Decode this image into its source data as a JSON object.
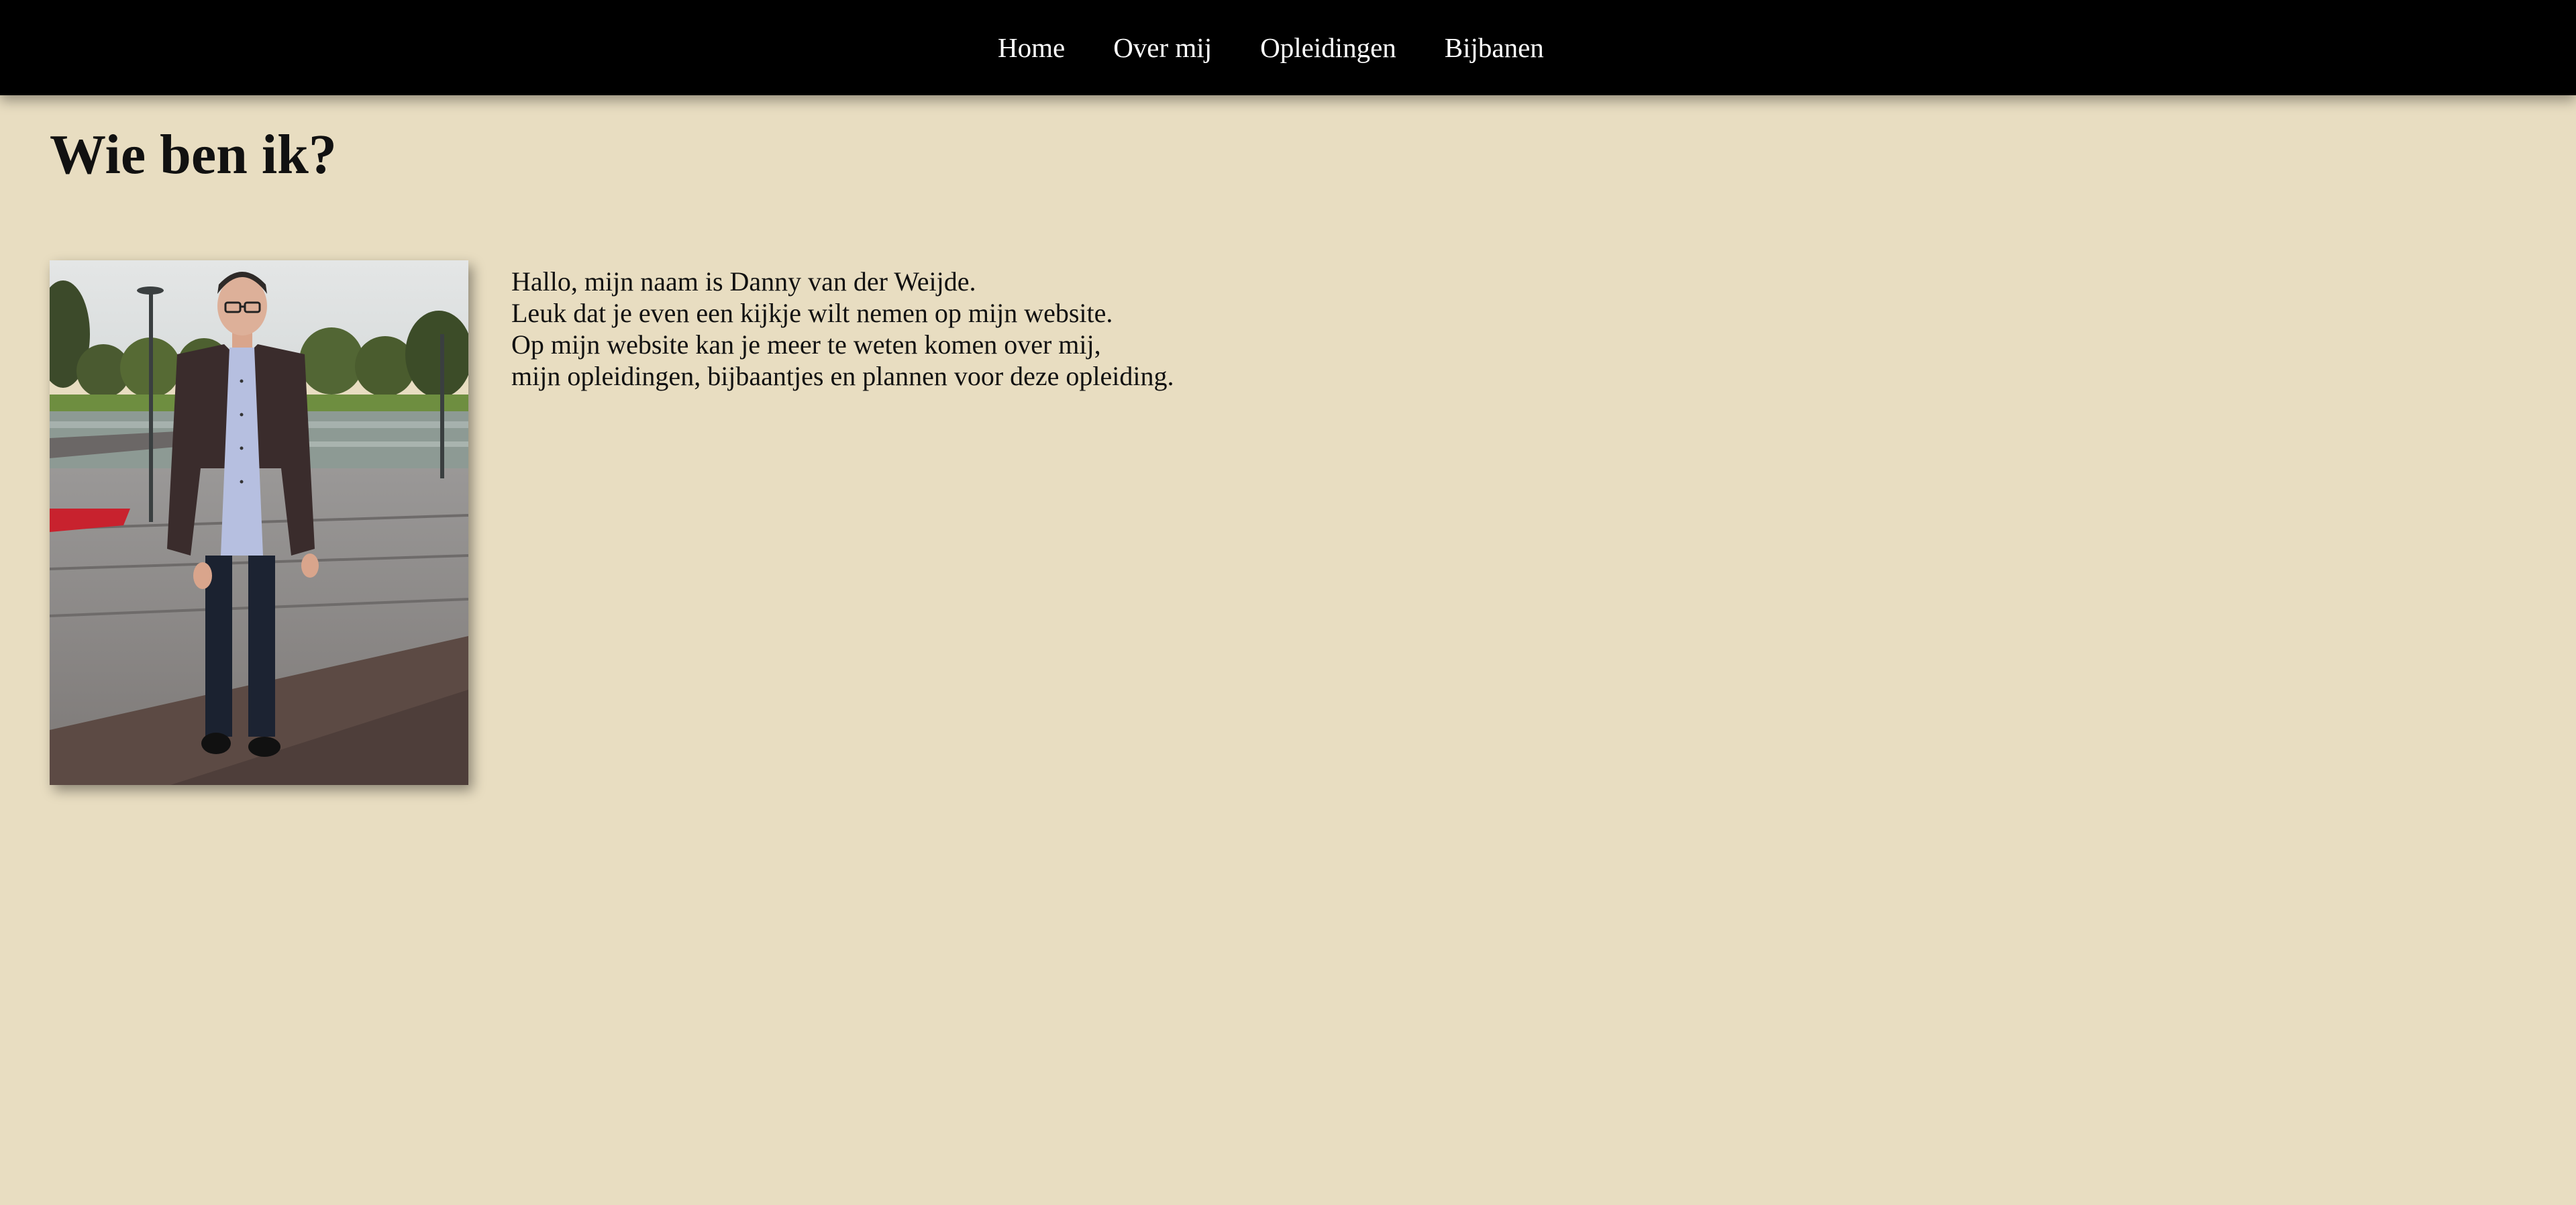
{
  "nav": {
    "items": [
      {
        "label": "Home"
      },
      {
        "label": "Over mij"
      },
      {
        "label": "Opleidingen"
      },
      {
        "label": "Bijbanen"
      }
    ]
  },
  "main": {
    "title": "Wie ben ik?",
    "intro_lines": [
      "Hallo, mijn naam is Danny van der Weijde.",
      "Leuk dat je even een kijkje wilt nemen op mijn website.",
      "Op mijn website kan je meer te weten komen over mij,",
      "mijn opleidingen, bijbaantjes en plannen voor deze opleiding."
    ]
  },
  "colors": {
    "background": "#e8ddc1",
    "navbar": "#000000",
    "nav_text": "#ffffff",
    "text": "#111111"
  }
}
